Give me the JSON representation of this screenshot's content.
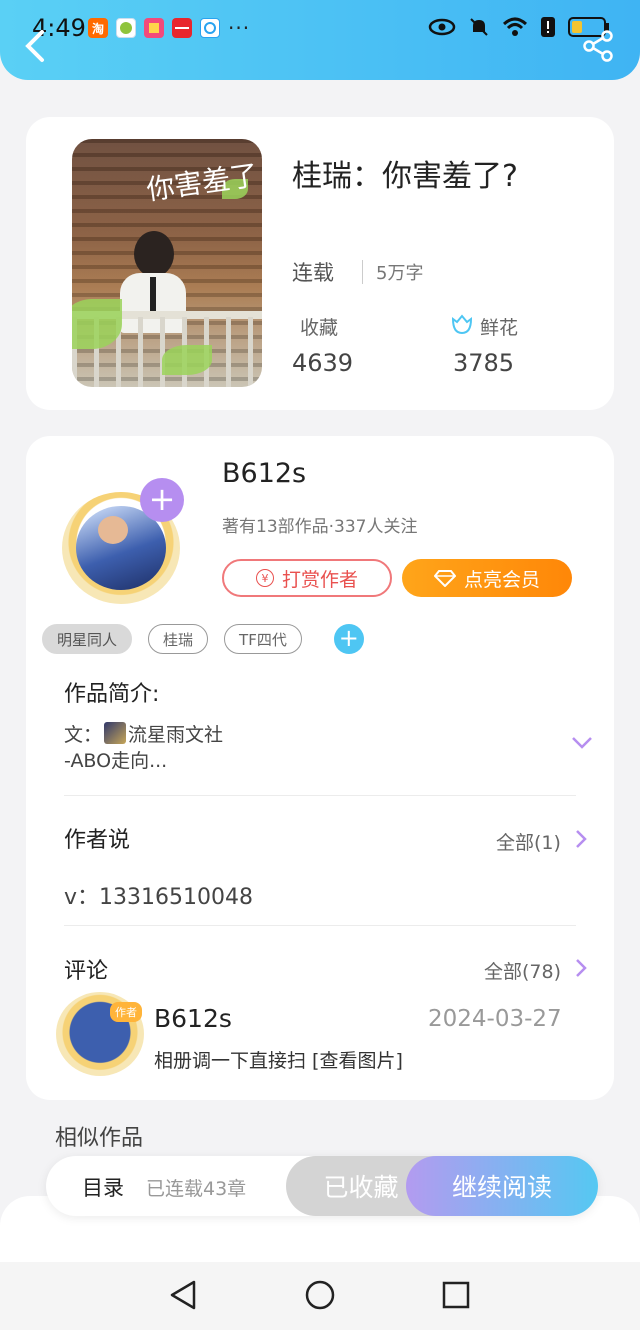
{
  "status_bar": {
    "time": "4:49",
    "notification_icons": [
      "taobao-icon",
      "app-icon",
      "app-icon",
      "huawei-icon",
      "app-icon"
    ],
    "more_dots": "···"
  },
  "book": {
    "title": "桂瑞：你害羞了?",
    "status": "连载",
    "words": "5万字",
    "favorites_label": "收藏",
    "favorites_count": "4639",
    "flowers_label": "鲜花",
    "flowers_count": "3785",
    "cover_title": "你害羞了"
  },
  "author": {
    "name": "B612s",
    "meta": "著有13部作品·337人关注",
    "tip_button": "打赏作者",
    "vip_button": "点亮会员",
    "tags": [
      "明星同人",
      "桂瑞",
      "TF四代"
    ]
  },
  "intro": {
    "title": "作品简介:",
    "line1_prefix": "文：",
    "line1_suffix": "流星雨文社",
    "line2": "-ABO走向..."
  },
  "author_says": {
    "title": "作者说",
    "see_all": "全部(1)",
    "text": "v：13316510048"
  },
  "comments": {
    "title": "评论",
    "see_all": "全部(78)",
    "items": [
      {
        "name": "B612s",
        "badge": "作者",
        "date": "2024-03-27",
        "text": "相册调一下直接扫 [查看图片]"
      }
    ]
  },
  "similar": {
    "title": "相似作品"
  },
  "action_bar": {
    "toc_label": "目录",
    "toc_count": "已连载43章",
    "collected": "已收藏",
    "continue": "继续阅读"
  },
  "colors": {
    "header": "#3fb4f3",
    "vip": "#ff8708",
    "tip": "#e9514f",
    "plus": "#b68ef0",
    "read_gradient_start": "#b39bf0",
    "read_gradient_end": "#55c8f2"
  }
}
